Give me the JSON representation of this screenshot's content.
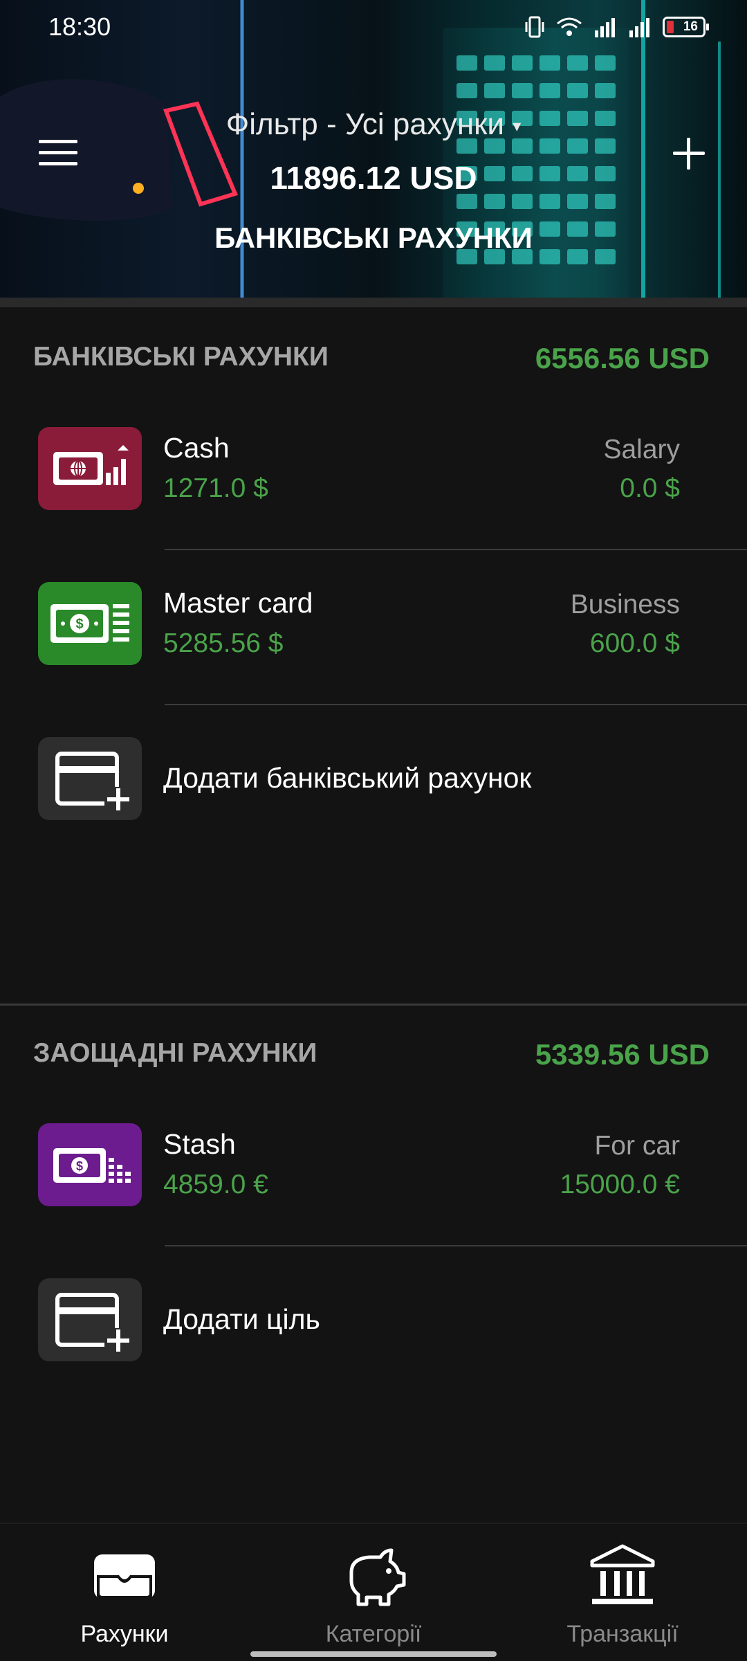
{
  "status_bar": {
    "time": "18:30",
    "battery": "16"
  },
  "header": {
    "filter_label": "Фільтр - Усі рахунки",
    "filter_caret": "▾",
    "total": "11896.12 USD",
    "subtitle": "БАНКІВСЬКІ РАХУНКИ",
    "menu_icon": "hamburger-menu-icon",
    "add_icon": "plus-icon"
  },
  "bank_section": {
    "title": "БАНКІВСЬКІ РАХУНКИ",
    "total": "6556.56 USD",
    "accounts": [
      {
        "name": "Cash",
        "balance": "1271.0 $",
        "goal_label": "Salary",
        "goal_value": "0.0 $",
        "icon": "cash-growth-icon",
        "color": "#8a1c3a"
      },
      {
        "name": "Master card",
        "balance": "5285.56 $",
        "goal_label": "Business",
        "goal_value": "600.0 $",
        "icon": "banknote-icon",
        "color": "#2a8a2a"
      }
    ],
    "add_label": "Додати банківський рахунок"
  },
  "savings_section": {
    "title": "ЗАОЩАДНІ РАХУНКИ",
    "total": "5339.56 USD",
    "accounts": [
      {
        "name": "Stash",
        "balance": "4859.0 €",
        "goal_label": "For car",
        "goal_value": "15000.0 €",
        "icon": "money-stack-icon",
        "color": "#6c1c8e"
      }
    ],
    "add_label": "Додати ціль"
  },
  "bottom_nav": {
    "items": [
      {
        "label": "Рахунки",
        "icon": "wallet-icon",
        "active": true
      },
      {
        "label": "Категорії",
        "icon": "piggy-bank-icon",
        "active": false
      },
      {
        "label": "Транзакції",
        "icon": "bank-building-icon",
        "active": false
      }
    ]
  },
  "colors": {
    "accent_green": "#4aa34a",
    "background": "#131313",
    "section_title": "#a6a6a6"
  }
}
